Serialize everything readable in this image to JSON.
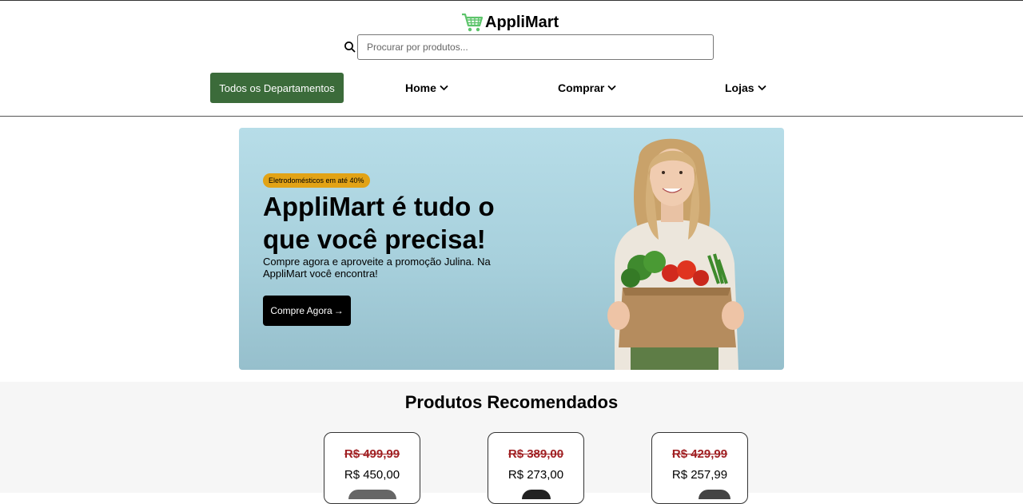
{
  "brand": {
    "name": "AppliMart",
    "icon": "shopping-cart-icon",
    "accent": "#5cc46a"
  },
  "search": {
    "placeholder": "Procurar por produtos...",
    "value": ""
  },
  "nav": {
    "departments_label": "Todos os Departamentos",
    "items": [
      {
        "label": "Home"
      },
      {
        "label": "Comprar"
      },
      {
        "label": "Lojas"
      }
    ]
  },
  "hero": {
    "badge": "Eletrodomésticos em até 40%",
    "title": "AppliMart é tudo o que você precisa!",
    "subtitle": "Compre agora e aproveite a promoção Julina. Na AppliMart você encontra!",
    "cta_label": "Compre Agora"
  },
  "recommended": {
    "title": "Produtos Recomendados",
    "products": [
      {
        "old_price": "R$ 499,99",
        "new_price": "R$ 450,00"
      },
      {
        "old_price": "R$ 389,00",
        "new_price": "R$ 273,00"
      },
      {
        "old_price": "R$ 429,99",
        "new_price": "R$ 257,99"
      }
    ]
  },
  "colors": {
    "primary_green": "#3b6b3a",
    "badge": "#e2a316",
    "old_price": "#a01f22"
  }
}
